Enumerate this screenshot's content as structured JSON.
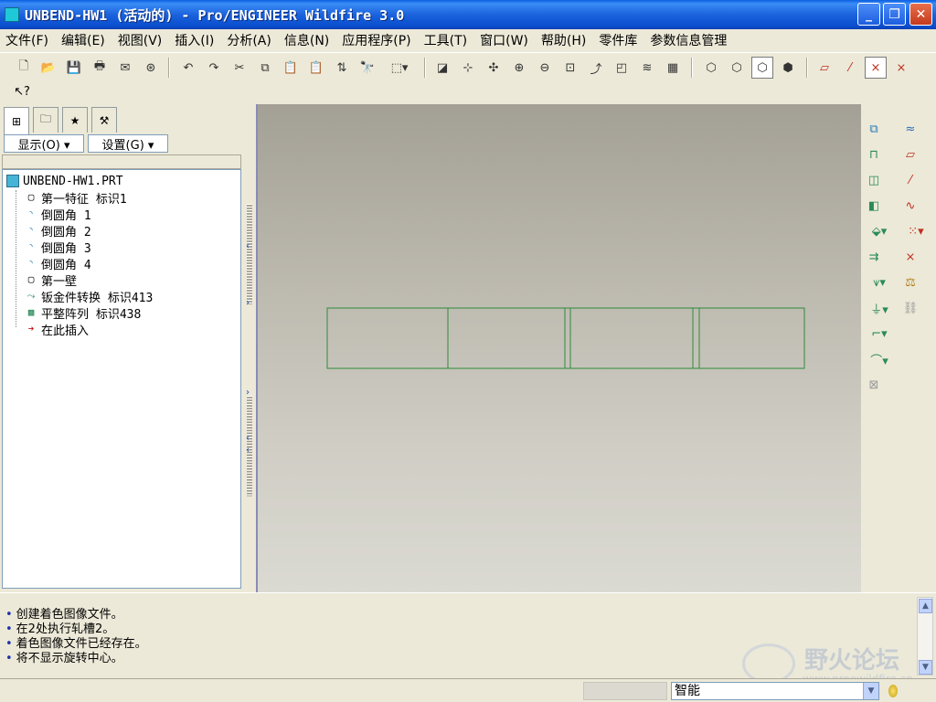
{
  "window": {
    "title": "UNBEND-HW1 (活动的) - Pro/ENGINEER Wildfire 3.0",
    "controls": {
      "minimize": "_",
      "maximize": "❐",
      "close": "✕"
    }
  },
  "menu": [
    "文件(F)",
    "编辑(E)",
    "视图(V)",
    "插入(I)",
    "分析(A)",
    "信息(N)",
    "应用程序(P)",
    "工具(T)",
    "窗口(W)",
    "帮助(H)",
    "零件库",
    "参数信息管理"
  ],
  "toolbar": {
    "icons": [
      "new-icon",
      "open-icon",
      "save-icon",
      "print-icon",
      "email-icon",
      "email-link-icon",
      "undo-icon",
      "redo-icon",
      "cut-icon",
      "copy-icon",
      "paste-icon",
      "paste-special-icon",
      "regenerate-icon",
      "find-icon",
      "select-box-icon",
      "repaint-icon",
      "spin-center-icon",
      "orient-icon",
      "zoom-in-icon",
      "zoom-out-icon",
      "refit-icon",
      "reorient-icon",
      "saved-views-icon",
      "layers-icon",
      "view-manager-icon",
      "wireframe-icon",
      "hidden-line-icon",
      "no-hidden-icon",
      "shading-icon",
      "datum-planes-icon",
      "datum-axes-icon",
      "datum-points-icon",
      "coord-sys-icon"
    ],
    "context_help": "↖?"
  },
  "left_panel": {
    "tabs": [
      "model-tree-tab",
      "folder-browser-tab",
      "favorites-tab",
      "connections-tab"
    ],
    "show_menu": "显示(O) ▾",
    "settings_menu": "设置(G) ▾",
    "tree": {
      "root": "UNBEND-HW1.PRT",
      "items": [
        {
          "icon": "first-feature-icon",
          "label": "第一特征 标识1"
        },
        {
          "icon": "round-icon",
          "label": "倒圆角 1"
        },
        {
          "icon": "round-icon",
          "label": "倒圆角 2"
        },
        {
          "icon": "round-icon",
          "label": "倒圆角 3"
        },
        {
          "icon": "round-icon",
          "label": "倒圆角 4"
        },
        {
          "icon": "first-wall-icon",
          "label": "第一壁"
        },
        {
          "icon": "sheetmetal-convert-icon",
          "label": "钣金件转换 标识413"
        },
        {
          "icon": "flat-pattern-icon",
          "label": "平整阵列 标识438"
        },
        {
          "icon": "insert-here-arrow-icon",
          "label": "在此插入"
        }
      ]
    }
  },
  "graphics": {
    "model_color": "#2e8b3a",
    "flat_pattern_panels": 4
  },
  "right_toolbar": {
    "icons": [
      "datum-plane-tool-icon",
      "sketch-tool-icon",
      "flat-wall-icon",
      "plane-datum-icon",
      "flange-wall-icon",
      "axis-datum-icon",
      "extrude-wall-icon",
      "curve-datum-icon",
      "unbend-icon",
      "point-datum-icon",
      "bend-back-icon",
      "csys-datum-icon",
      "cut-icon",
      "analysis-feature-icon",
      "punch-icon",
      "pattern-icon",
      "form-icon",
      "flatten-icon",
      "rip-icon"
    ]
  },
  "messages": [
    "创建着色图像文件。",
    "在2处执行轧槽2。",
    "着色图像文件已经存在。",
    "将不显示旋转中心。"
  ],
  "watermark": {
    "text": "野火论坛",
    "url": "www.proewildfire.cn"
  },
  "status": {
    "filter_value": "智能"
  }
}
